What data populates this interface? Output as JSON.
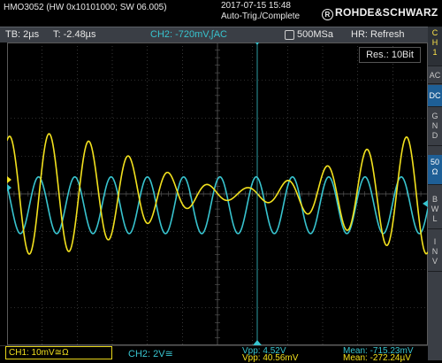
{
  "header": {
    "model": "HMO3052 (HW 0x10101000; SW 06.005)",
    "date_time": "2017-07-15 15:48",
    "trigger_state": "Auto-Trig./Complete",
    "brand": "ROHDE&SCHWARZ",
    "brand_mark": "R"
  },
  "status": {
    "timebase": "TB: 2µs",
    "trigger_time": "T: -2.48µs",
    "ch2_setting": "CH2: -720mV,∫AC",
    "sample_rate": "500MSa",
    "hr_mode": "HR: Refresh"
  },
  "resolution": "Res.: 10Bit",
  "side_panel": {
    "channel": [
      "C",
      "H",
      "1"
    ],
    "coupling_ac": "AC",
    "coupling_dc": "DC",
    "gnd": [
      "G",
      "N",
      "D"
    ],
    "imp": [
      "50",
      "Ω"
    ],
    "bwl": [
      "B",
      "W",
      "L"
    ],
    "inv": [
      "I",
      "N",
      "V"
    ]
  },
  "footer": {
    "ch1_label": "CH1: 10mV≅Ω",
    "ch2_label": "CH2: 2V≅",
    "vpp_ch2": "Vpp: 4.52V",
    "vpp_ch1": "Vpp: 40.56mV",
    "mean_ch2": "Mean: -715.23mV",
    "mean_ch1": "Mean: -272.24µV"
  },
  "colors": {
    "ch1": "#f2e11e",
    "ch2": "#38c4cf",
    "grid": "#5a5a5a",
    "panel": "#3a3e45",
    "active_button": "#1e5f96"
  },
  "grid_divisions": {
    "horizontal": 12,
    "vertical": 8
  },
  "waveforms": [
    {
      "name": "CH1",
      "color": "#f2e11e",
      "cycles_on_screen": 10.6,
      "amplitude_div": 1.6,
      "envelope": "amplitude-modulated (beating)",
      "offset_div": 0.0
    },
    {
      "name": "CH2",
      "color": "#38c4cf",
      "cycles_on_screen": 11.6,
      "amplitude_div": 0.75,
      "envelope": "constant",
      "offset_div": -0.3
    }
  ]
}
